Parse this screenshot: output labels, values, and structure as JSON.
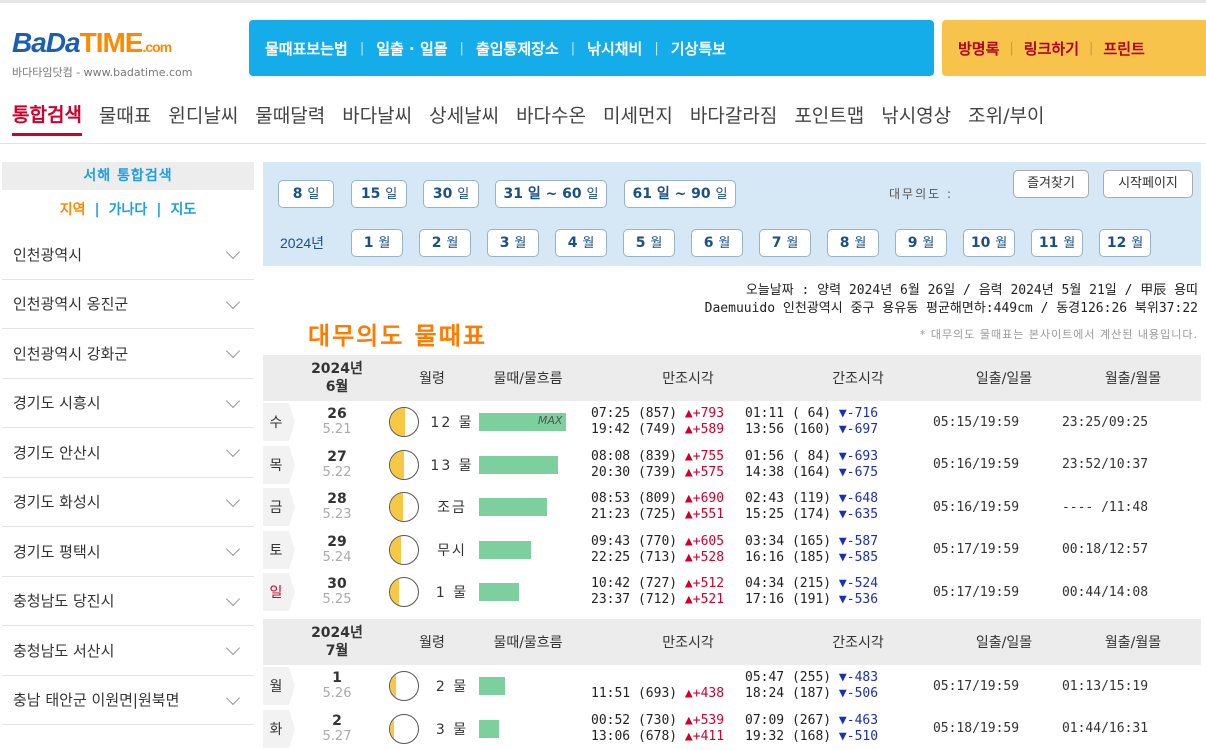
{
  "logo": {
    "brand_a": "BaDa",
    "brand_b": "TIME",
    "brand_c": ".com",
    "sub": "바다타임닷컴 - www.badatime.com"
  },
  "topnav": [
    "물때표보는법",
    "일출 · 일몰",
    "출입통제장소",
    "낚시채비",
    "기상특보"
  ],
  "topright": [
    "방명록",
    "링크하기",
    "프린트"
  ],
  "mainnav": [
    "통합검색",
    "물때표",
    "윈디날씨",
    "물때달력",
    "바다날씨",
    "상세날씨",
    "바다수온",
    "미세먼지",
    "바다갈라짐",
    "포인트맵",
    "낚시영상",
    "조위/부이"
  ],
  "sidebar": {
    "title": "서해 통합검색",
    "links": [
      "지역",
      "가나다",
      "지도"
    ],
    "items": [
      "인천광역시",
      "인천광역시 옹진군",
      "인천광역시 강화군",
      "경기도 시흥시",
      "경기도 안산시",
      "경기도 화성시",
      "경기도 평택시",
      "충청남도 당진시",
      "충청남도 서산시",
      "충남 태안군 이원면|원북면"
    ]
  },
  "filter": {
    "range": [
      {
        "num": "8",
        "unit": "일"
      },
      {
        "num": "15",
        "unit": "일"
      },
      {
        "num": "30",
        "unit": "일"
      },
      {
        "num": "31 일 ~ 60",
        "unit": "일"
      },
      {
        "num": "61 일 ~ 90",
        "unit": "일"
      }
    ],
    "year": "2024년",
    "months": [
      {
        "num": "1",
        "unit": "월"
      },
      {
        "num": "2",
        "unit": "월"
      },
      {
        "num": "3",
        "unit": "월"
      },
      {
        "num": "4",
        "unit": "월"
      },
      {
        "num": "5",
        "unit": "월"
      },
      {
        "num": "6",
        "unit": "월"
      },
      {
        "num": "7",
        "unit": "월"
      },
      {
        "num": "8",
        "unit": "월"
      },
      {
        "num": "9",
        "unit": "월"
      },
      {
        "num": "10",
        "unit": "월"
      },
      {
        "num": "11",
        "unit": "월"
      },
      {
        "num": "12",
        "unit": "월"
      }
    ],
    "place": "대무의도 :",
    "favorite": "즐겨찾기",
    "homepage": "시작페이지"
  },
  "info": {
    "line1": "오늘날짜 : 양력 2024년 6월 26일 / 음력 2024년 5월 21일 / 甲辰 용띠",
    "line2": "Daemuuido 인천광역시 중구 용유동 평균해면하:449cm / 동경126:26 북위37:22",
    "note": "* 대무의도 물때표는 본사이트에서 계산된 내용입니다."
  },
  "page_title": "대무의도 물때표",
  "table_headers": {
    "moon": "월령",
    "tide": "물때/물흐름",
    "high": "만조시각",
    "low": "간조시각",
    "sun": "일출/일몰",
    "moonrs": "월출/월몰"
  },
  "months": [
    {
      "label_year": "2024년",
      "label_month": "6월",
      "rows": [
        {
          "day": "수",
          "date": "26",
          "lunar": "5.21",
          "moon_lit": 0.55,
          "tide": "12 물",
          "flow": 0.95,
          "max": "MAX",
          "h1": "07:25 (857)",
          "h1d": "▲+793",
          "h2": "19:42 (749)",
          "h2d": "▲+589",
          "l1": "01:11 ( 64)",
          "l1d": "▼-716",
          "l2": "13:56 (160)",
          "l2d": "▼-697",
          "sun": "05:15/19:59",
          "moonrs": "23:25/09:25",
          "sunday": false
        },
        {
          "day": "목",
          "date": "27",
          "lunar": "5.22",
          "moon_lit": 0.5,
          "tide": "13 물",
          "flow": 0.86,
          "max": "",
          "h1": "08:08 (839)",
          "h1d": "▲+755",
          "h2": "20:30 (739)",
          "h2d": "▲+575",
          "l1": "01:56 ( 84)",
          "l1d": "▼-693",
          "l2": "14:38 (164)",
          "l2d": "▼-675",
          "sun": "05:16/19:59",
          "moonrs": "23:52/10:37",
          "sunday": false
        },
        {
          "day": "금",
          "date": "28",
          "lunar": "5.23",
          "moon_lit": 0.45,
          "tide": "조금",
          "flow": 0.74,
          "max": "",
          "h1": "08:53 (809)",
          "h1d": "▲+690",
          "h2": "21:23 (725)",
          "h2d": "▲+551",
          "l1": "02:43 (119)",
          "l1d": "▼-648",
          "l2": "15:25 (174)",
          "l2d": "▼-635",
          "sun": "05:16/19:59",
          "moonrs": "---- /11:48",
          "sunday": false
        },
        {
          "day": "토",
          "date": "29",
          "lunar": "5.24",
          "moon_lit": 0.38,
          "tide": "무시",
          "flow": 0.56,
          "max": "",
          "h1": "09:43 (770)",
          "h1d": "▲+605",
          "h2": "22:25 (713)",
          "h2d": "▲+528",
          "l1": "03:34 (165)",
          "l1d": "▼-587",
          "l2": "16:16 (185)",
          "l2d": "▼-585",
          "sun": "05:17/19:59",
          "moonrs": "00:18/12:57",
          "sunday": false
        },
        {
          "day": "일",
          "date": "30",
          "lunar": "5.25",
          "moon_lit": 0.32,
          "tide": "1 물",
          "flow": 0.43,
          "max": "",
          "h1": "10:42 (727)",
          "h1d": "▲+512",
          "h2": "23:37 (712)",
          "h2d": "▲+521",
          "l1": "04:34 (215)",
          "l1d": "▼-524",
          "l2": "17:16 (191)",
          "l2d": "▼-536",
          "sun": "05:17/19:59",
          "moonrs": "00:44/14:08",
          "sunday": true
        }
      ]
    },
    {
      "label_year": "2024년",
      "label_month": "7월",
      "rows": [
        {
          "day": "월",
          "date": "1",
          "lunar": "5.26",
          "moon_lit": 0.22,
          "tide": "2 물",
          "flow": 0.28,
          "max": "",
          "h1": "",
          "h1d": "",
          "h2": "11:51 (693)",
          "h2d": "▲+438",
          "l1": "05:47 (255)",
          "l1d": "▼-483",
          "l2": "18:24 (187)",
          "l2d": "▼-506",
          "sun": "05:17/19:59",
          "moonrs": "01:13/15:19",
          "sunday": false
        },
        {
          "day": "화",
          "date": "2",
          "lunar": "5.27",
          "moon_lit": 0.15,
          "tide": "3 물",
          "flow": 0.22,
          "max": "",
          "h1": "00:52 (730)",
          "h1d": "▲+539",
          "h2": "13:06 (678)",
          "h2d": "▲+411",
          "l1": "07:09 (267)",
          "l1d": "▼-463",
          "l2": "19:32 (168)",
          "l2d": "▼-510",
          "sun": "05:18/19:59",
          "moonrs": "01:44/16:31",
          "sunday": false
        }
      ]
    }
  ]
}
